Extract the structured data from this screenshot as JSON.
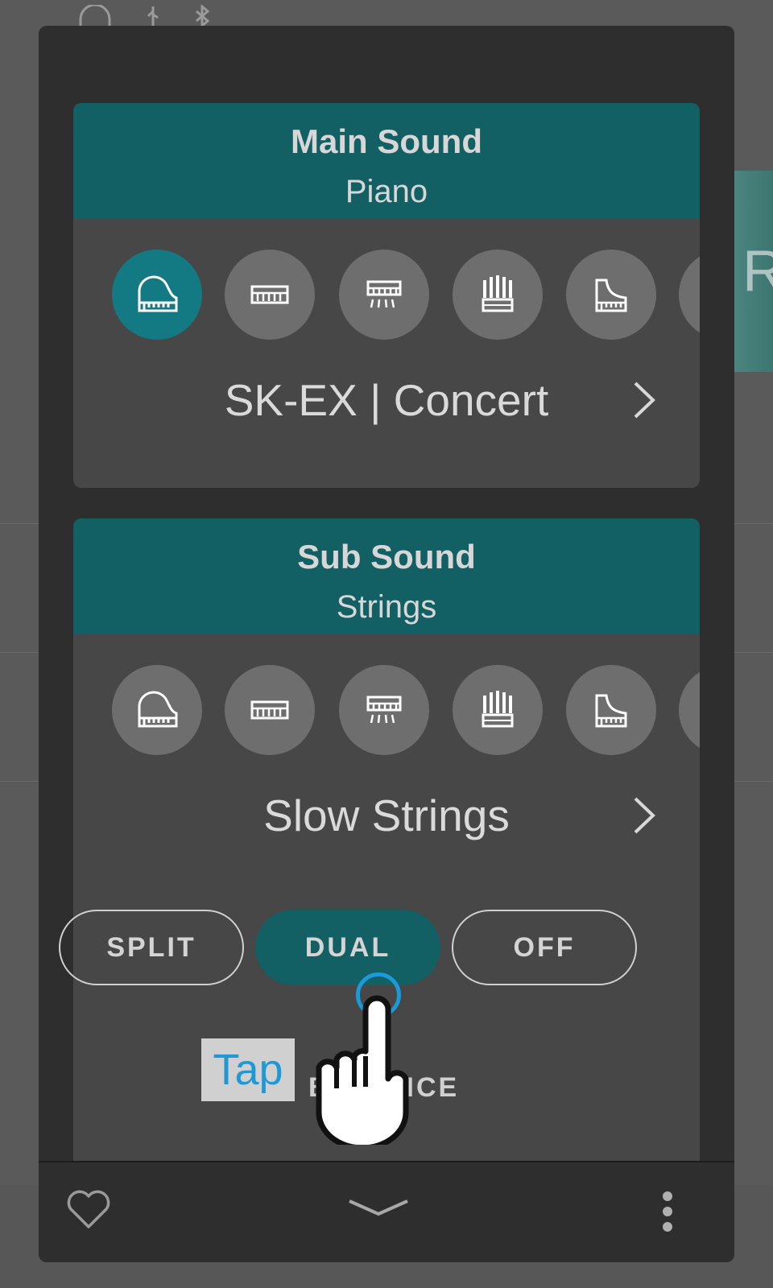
{
  "main_sound": {
    "title": "Main Sound",
    "category": "Piano",
    "sound_name": "SK-EX | Concert",
    "icons": [
      "grand-piano-icon",
      "keyboard-icon",
      "electric-piano-icon",
      "organ-icon",
      "upright-piano-icon",
      "more-icon"
    ],
    "selected_icon": "grand-piano-icon"
  },
  "sub_sound": {
    "title": "Sub Sound",
    "category": "Strings",
    "sound_name": "Slow Strings",
    "icons": [
      "grand-piano-icon",
      "keyboard-icon",
      "electric-piano-icon",
      "organ-icon",
      "upright-piano-icon",
      "more-icon"
    ]
  },
  "modes": {
    "split": "SPLIT",
    "dual": "DUAL",
    "off": "OFF",
    "selected": "DUAL"
  },
  "balance_label": "BALANCE",
  "tap_hint": "Tap",
  "colors": {
    "accent": "#125f64",
    "selected_icon": "#137a84",
    "tap_highlight": "#1a9ad8"
  },
  "bottom_bar": {
    "icons": [
      "heart-icon",
      "collapse-chevron-icon",
      "more-vertical-icon"
    ]
  }
}
